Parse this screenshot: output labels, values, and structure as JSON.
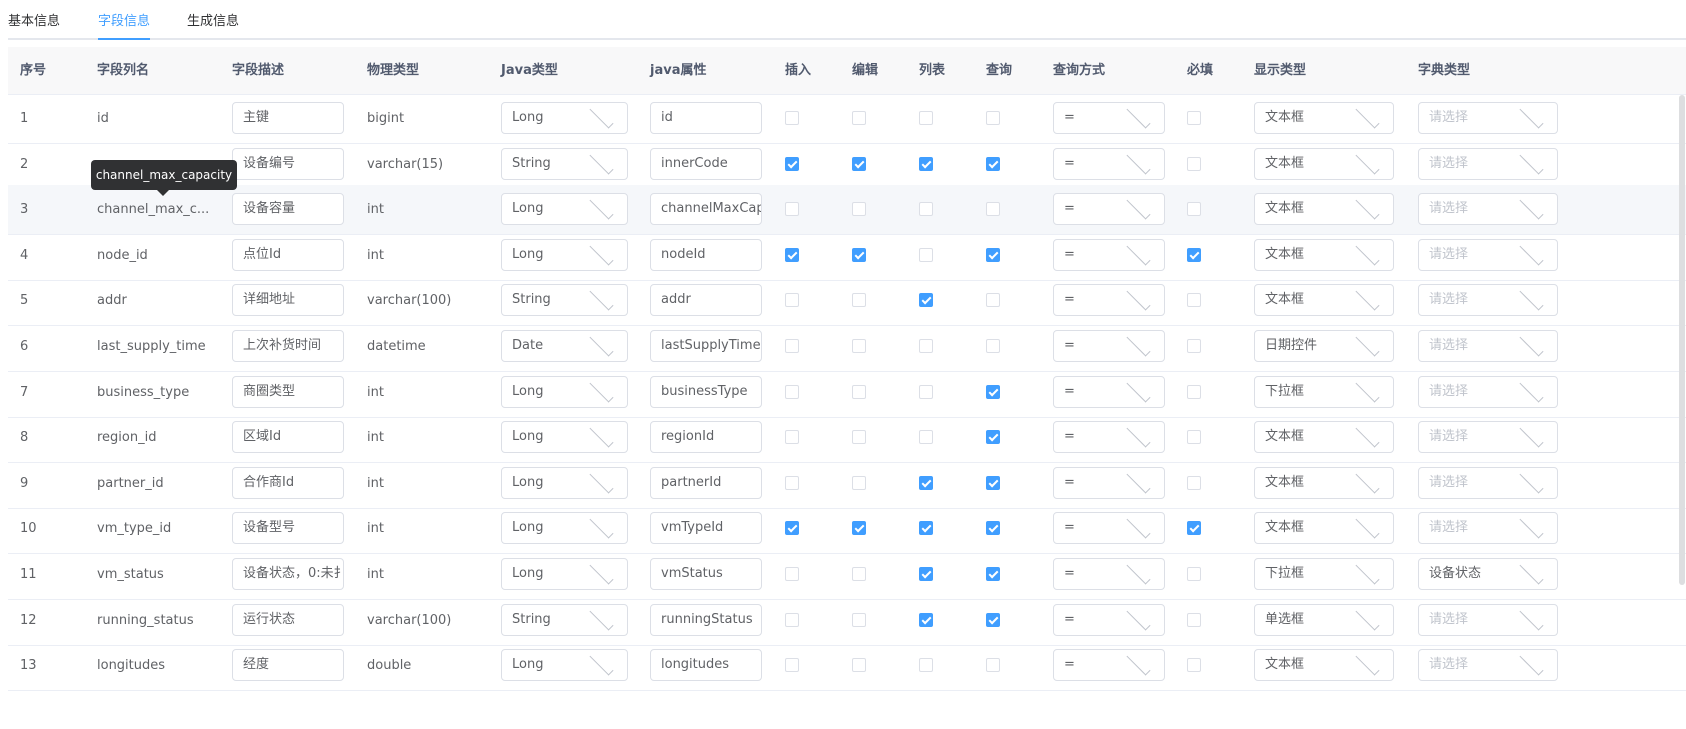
{
  "tabs": [
    {
      "label": "基本信息"
    },
    {
      "label": "字段信息"
    },
    {
      "label": "生成信息"
    }
  ],
  "headers": {
    "seq": "序号",
    "col_name": "字段列名",
    "desc": "字段描述",
    "phys_type": "物理类型",
    "java_type": "Java类型",
    "java_attr": "java属性",
    "insert": "插入",
    "edit": "编辑",
    "list": "列表",
    "query": "查询",
    "query_type": "查询方式",
    "required": "必填",
    "display_type": "显示类型",
    "dict_type": "字典类型"
  },
  "tooltip": "channel_max_capacity",
  "dict_placeholder": "请选择",
  "rows": [
    {
      "seq": "1",
      "col": "id",
      "desc": "主键",
      "phys": "bigint",
      "java": "Long",
      "attr": "id",
      "ins": false,
      "edit": false,
      "list": false,
      "query": false,
      "qtype": "=",
      "req": false,
      "disp": "文本框",
      "dict": ""
    },
    {
      "seq": "2",
      "col": "",
      "desc": "设备编号",
      "phys": "varchar(15)",
      "java": "String",
      "attr": "innerCode",
      "ins": true,
      "edit": true,
      "list": true,
      "query": true,
      "qtype": "=",
      "req": false,
      "disp": "文本框",
      "dict": ""
    },
    {
      "seq": "3",
      "col": "channel_max_c...",
      "desc": "设备容量",
      "phys": "int",
      "java": "Long",
      "attr": "channelMaxCap",
      "ins": false,
      "edit": false,
      "list": false,
      "query": false,
      "qtype": "=",
      "req": false,
      "disp": "文本框",
      "dict": ""
    },
    {
      "seq": "4",
      "col": "node_id",
      "desc": "点位Id",
      "phys": "int",
      "java": "Long",
      "attr": "nodeId",
      "ins": true,
      "edit": true,
      "list": false,
      "query": true,
      "qtype": "=",
      "req": true,
      "disp": "文本框",
      "dict": ""
    },
    {
      "seq": "5",
      "col": "addr",
      "desc": "详细地址",
      "phys": "varchar(100)",
      "java": "String",
      "attr": "addr",
      "ins": false,
      "edit": false,
      "list": true,
      "query": false,
      "qtype": "=",
      "req": false,
      "disp": "文本框",
      "dict": ""
    },
    {
      "seq": "6",
      "col": "last_supply_time",
      "desc": "上次补货时间",
      "phys": "datetime",
      "java": "Date",
      "attr": "lastSupplyTime",
      "ins": false,
      "edit": false,
      "list": false,
      "query": false,
      "qtype": "=",
      "req": false,
      "disp": "日期控件",
      "dict": ""
    },
    {
      "seq": "7",
      "col": "business_type",
      "desc": "商圈类型",
      "phys": "int",
      "java": "Long",
      "attr": "businessType",
      "ins": false,
      "edit": false,
      "list": false,
      "query": true,
      "qtype": "=",
      "req": false,
      "disp": "下拉框",
      "dict": ""
    },
    {
      "seq": "8",
      "col": "region_id",
      "desc": "区域Id",
      "phys": "int",
      "java": "Long",
      "attr": "regionId",
      "ins": false,
      "edit": false,
      "list": false,
      "query": true,
      "qtype": "=",
      "req": false,
      "disp": "文本框",
      "dict": ""
    },
    {
      "seq": "9",
      "col": "partner_id",
      "desc": "合作商Id",
      "phys": "int",
      "java": "Long",
      "attr": "partnerId",
      "ins": false,
      "edit": false,
      "list": true,
      "query": true,
      "qtype": "=",
      "req": false,
      "disp": "文本框",
      "dict": ""
    },
    {
      "seq": "10",
      "col": "vm_type_id",
      "desc": "设备型号",
      "phys": "int",
      "java": "Long",
      "attr": "vmTypeId",
      "ins": true,
      "edit": true,
      "list": true,
      "query": true,
      "qtype": "=",
      "req": true,
      "disp": "文本框",
      "dict": ""
    },
    {
      "seq": "11",
      "col": "vm_status",
      "desc": "设备状态，0:未扌",
      "phys": "int",
      "java": "Long",
      "attr": "vmStatus",
      "ins": false,
      "edit": false,
      "list": true,
      "query": true,
      "qtype": "=",
      "req": false,
      "disp": "下拉框",
      "dict": "设备状态"
    },
    {
      "seq": "12",
      "col": "running_status",
      "desc": "运行状态",
      "phys": "varchar(100)",
      "java": "String",
      "attr": "runningStatus",
      "ins": false,
      "edit": false,
      "list": true,
      "query": true,
      "qtype": "=",
      "req": false,
      "disp": "单选框",
      "dict": ""
    },
    {
      "seq": "13",
      "col": "longitudes",
      "desc": "经度",
      "phys": "double",
      "java": "Long",
      "attr": "longitudes",
      "ins": false,
      "edit": false,
      "list": false,
      "query": false,
      "qtype": "=",
      "req": false,
      "disp": "文本框",
      "dict": ""
    }
  ]
}
